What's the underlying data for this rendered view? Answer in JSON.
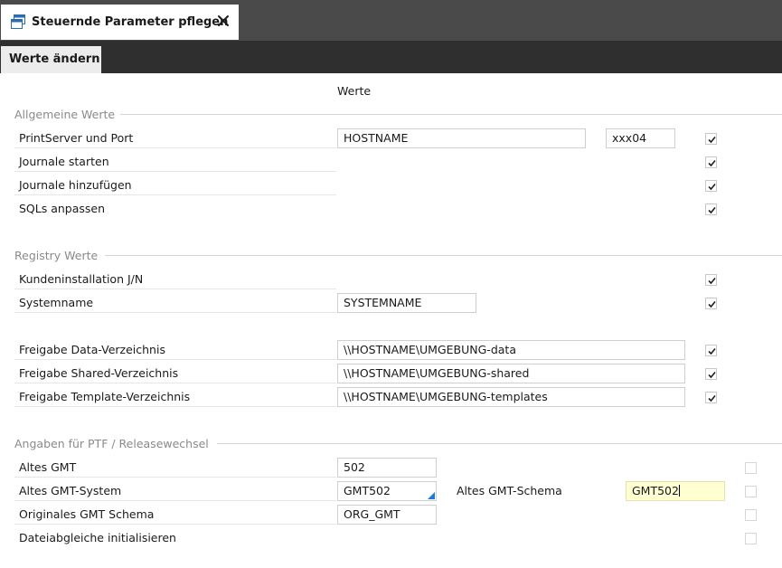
{
  "window": {
    "tab_title": "Steuernde Parameter pflegen",
    "subtab_label": "Werte ändern"
  },
  "column_header": "Werte",
  "sections": {
    "allgemein": {
      "title": "Allgemeine Werte",
      "printserver_label": "PrintServer und Port",
      "printserver_host": "HOSTNAME",
      "printserver_port": "xxx04",
      "printserver_checked": true,
      "journale_starten_label": "Journale starten",
      "journale_starten_checked": true,
      "journale_hinzufuegen_label": "Journale hinzufügen",
      "journale_hinzufuegen_checked": true,
      "sqls_anpassen_label": "SQLs anpassen",
      "sqls_anpassen_checked": true
    },
    "registry": {
      "title": "Registry Werte",
      "kundeninstallation_label": "Kundeninstallation J/N",
      "kundeninstallation_checked": true,
      "systemname_label": "Systemname",
      "systemname_value": "SYSTEMNAME",
      "systemname_checked": true,
      "data_label": "Freigabe Data-Verzeichnis",
      "data_value": "\\\\HOSTNAME\\UMGEBUNG-data",
      "data_checked": true,
      "shared_label": "Freigabe Shared-Verzeichnis",
      "shared_value": "\\\\HOSTNAME\\UMGEBUNG-shared",
      "shared_checked": true,
      "template_label": "Freigabe Template-Verzeichnis",
      "template_value": "\\\\HOSTNAME\\UMGEBUNG-templates",
      "template_checked": true
    },
    "ptf": {
      "title": "Angaben für PTF / Releasewechsel",
      "altes_gmt_label": "Altes GMT",
      "altes_gmt_value": "502",
      "altes_gmt_checked": false,
      "altes_gmt_system_label": "Altes GMT-System",
      "altes_gmt_system_value": "GMT502",
      "altes_gmt_schema_label": "Altes GMT-Schema",
      "altes_gmt_schema_value": "GMT502",
      "altes_gmt_system_checked": false,
      "originales_label": "Originales GMT Schema",
      "originales_value": "ORG_GMT",
      "originales_checked": false,
      "dateiabgleiche_label": "Dateiabgleiche initialisieren",
      "dateiabgleiche_checked": false
    }
  },
  "colors": {
    "tab_bar": "#4a4a4a",
    "subtab_bar": "#2f2f2f",
    "focus_field": "#ffffd2",
    "dropdown_accent": "#1f7ad6"
  }
}
